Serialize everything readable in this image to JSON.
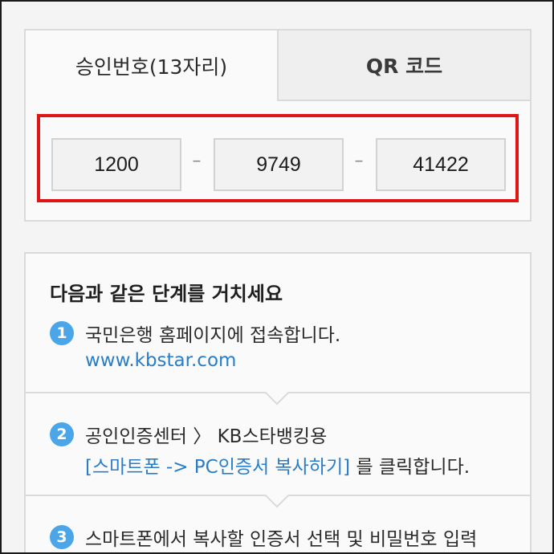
{
  "tabs": {
    "approval_label": "승인번호(13자리)",
    "qr_label": "QR 코드"
  },
  "approval_code": {
    "part1": "1200",
    "part2": "9749",
    "part3": "41422",
    "separator": "–"
  },
  "steps": {
    "title": "다음과 같은 단계를 거치세요",
    "items": [
      {
        "number": "1",
        "text": "국민은행 홈페이지에 접속합니다.",
        "link": "www.kbstar.com"
      },
      {
        "number": "2",
        "text": "공인인증센터 〉 KB스타뱅킹용",
        "link": "[스마트폰 -> PC인증서 복사하기]",
        "suffix": "를 클릭합니다."
      },
      {
        "number": "3",
        "text": "스마트폰에서 복사할 인증서 선택 및 비밀번호 입력"
      }
    ]
  },
  "colors": {
    "highlight_border": "#e01616",
    "step_badge": "#4aa6e8",
    "link": "#2a7ec7"
  }
}
